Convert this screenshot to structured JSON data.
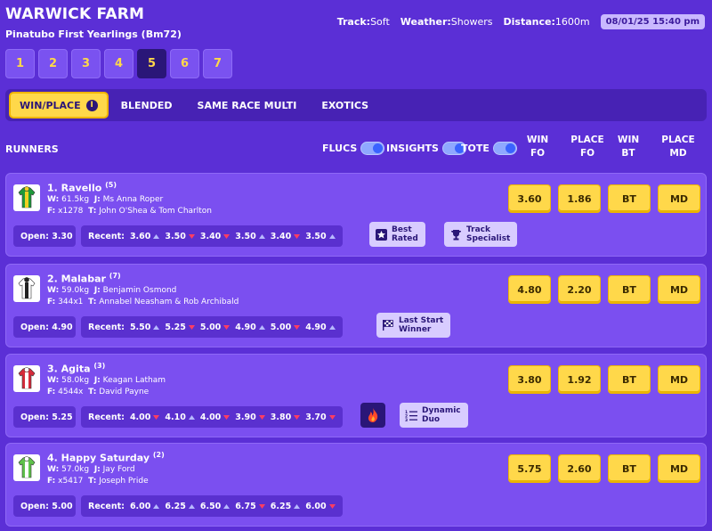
{
  "header": {
    "venue": "WARWICK FARM",
    "race_name": "Pinatubo First Yearlings (Bm72)",
    "track_label": "Track:",
    "track_value": "Soft",
    "weather_label": "Weather:",
    "weather_value": "Showers",
    "distance_label": "Distance:",
    "distance_value": "1600m",
    "datetime": "08/01/25 15:40 pm"
  },
  "race_tabs": [
    "1",
    "2",
    "3",
    "4",
    "5",
    "6",
    "7"
  ],
  "active_race": "5",
  "bet_tabs": {
    "win_place": "WIN/PLACE",
    "blended": "BLENDED",
    "same_race_multi": "SAME RACE MULTI",
    "exotics": "EXOTICS"
  },
  "toolbar": {
    "runners": "RUNNERS",
    "flucs": "FLUCS",
    "insights": "INSIGHTS",
    "tote": "TOTE",
    "columns": [
      {
        "l1": "WIN",
        "l2": "FO"
      },
      {
        "l1": "PLACE",
        "l2": "FO"
      },
      {
        "l1": "WIN",
        "l2": "BT"
      },
      {
        "l1": "PLACE",
        "l2": "MD"
      }
    ]
  },
  "runners": [
    {
      "name": "1. Ravello",
      "barrier": "(5)",
      "weight": "61.5kg",
      "jockey": "Ms Anna Roper",
      "form": "x1278",
      "trainer": "John O'Shea & Tom Charlton",
      "open": "3.30",
      "recent": [
        [
          "3.60",
          "up"
        ],
        [
          "3.50",
          "down"
        ],
        [
          "3.40",
          "down"
        ],
        [
          "3.50",
          "up"
        ],
        [
          "3.40",
          "down"
        ],
        [
          "3.50",
          "up"
        ]
      ],
      "win_fo": "3.60",
      "place_fo": "1.86",
      "win_bt": "BT",
      "place_md": "MD",
      "badges": [
        {
          "icon": "star-icon",
          "l1": "Best",
          "l2": "Rated"
        },
        {
          "icon": "trophy-icon",
          "l1": "Track",
          "l2": "Specialist"
        }
      ],
      "silk": {
        "primary": "#1e9a3a",
        "secondary": "#f0d020"
      }
    },
    {
      "name": "2. Malabar",
      "barrier": "(7)",
      "weight": "59.0kg",
      "jockey": "Benjamin Osmond",
      "form": "344x1",
      "trainer": "Annabel Neasham & Rob Archibald",
      "open": "4.90",
      "recent": [
        [
          "5.50",
          "up"
        ],
        [
          "5.25",
          "down"
        ],
        [
          "5.00",
          "down"
        ],
        [
          "4.90",
          "up"
        ],
        [
          "5.00",
          "down"
        ],
        [
          "4.90",
          "up"
        ]
      ],
      "win_fo": "4.80",
      "place_fo": "2.20",
      "win_bt": "BT",
      "place_md": "MD",
      "badges": [
        {
          "icon": "chequered-flag-icon",
          "l1": "Last Start",
          "l2": "Winner"
        }
      ],
      "silk": {
        "primary": "#ffffff",
        "secondary": "#222222"
      }
    },
    {
      "name": "3. Agita",
      "barrier": "(3)",
      "weight": "58.0kg",
      "jockey": "Keagan Latham",
      "form": "4544x",
      "trainer": "David Payne",
      "open": "5.25",
      "recent": [
        [
          "4.00",
          "down"
        ],
        [
          "4.10",
          "up"
        ],
        [
          "4.00",
          "down"
        ],
        [
          "3.90",
          "down"
        ],
        [
          "3.80",
          "down"
        ],
        [
          "3.70",
          "down"
        ]
      ],
      "win_fo": "3.80",
      "place_fo": "1.92",
      "win_bt": "BT",
      "place_md": "MD",
      "badges": [
        {
          "icon": "list-icon",
          "l1": "Dynamic",
          "l2": "Duo"
        }
      ],
      "silk": {
        "primary": "#d62b3a",
        "secondary": "#ffffff"
      }
    },
    {
      "name": "4. Happy Saturday",
      "barrier": "(2)",
      "weight": "57.0kg",
      "jockey": "Jay Ford",
      "form": "x5417",
      "trainer": "Joseph Pride",
      "open": "5.00",
      "recent": [
        [
          "6.00",
          "up"
        ],
        [
          "6.25",
          "up"
        ],
        [
          "6.50",
          "up"
        ],
        [
          "6.75",
          "down"
        ],
        [
          "6.25",
          "up"
        ],
        [
          "6.00",
          "down"
        ]
      ],
      "win_fo": "5.75",
      "place_fo": "2.60",
      "win_bt": "BT",
      "place_md": "MD",
      "badges": [],
      "silk": {
        "primary": "#5fc24a",
        "secondary": "#ffffff"
      }
    }
  ],
  "colors": {
    "background": "#5b2fd6",
    "card": "#7b4ff0",
    "odds_button": "#ffd84a",
    "down_arrow": "#ff3d62"
  }
}
